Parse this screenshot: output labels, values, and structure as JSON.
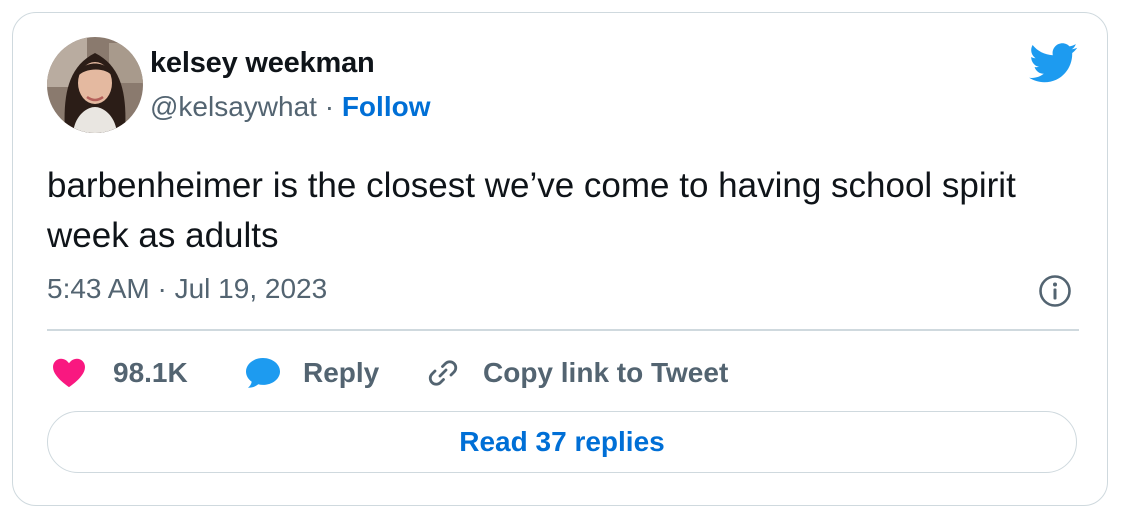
{
  "author": {
    "name": "kelsey weekman",
    "handle": "@kelsaywhat",
    "separator": "·",
    "follow_label": "Follow"
  },
  "tweet": {
    "text": "barbenheimer is the closest we’ve come to having school spirit week as adults",
    "timestamp": "5:43 AM · Jul 19, 2023"
  },
  "actions": {
    "likes": "98.1K",
    "reply_label": "Reply",
    "copy_link_label": "Copy link to Tweet"
  },
  "footer": {
    "read_replies_label": "Read 37 replies"
  },
  "icons": {
    "logo": "twitter-bird-icon",
    "like": "heart-icon",
    "reply": "speech-bubble-icon",
    "copy": "link-icon",
    "info": "info-icon"
  },
  "colors": {
    "brand_blue": "#1d9bf0",
    "link_blue": "#006fd6",
    "like_pink": "#f91880",
    "muted_text": "#536471",
    "border": "#cfd9de"
  }
}
